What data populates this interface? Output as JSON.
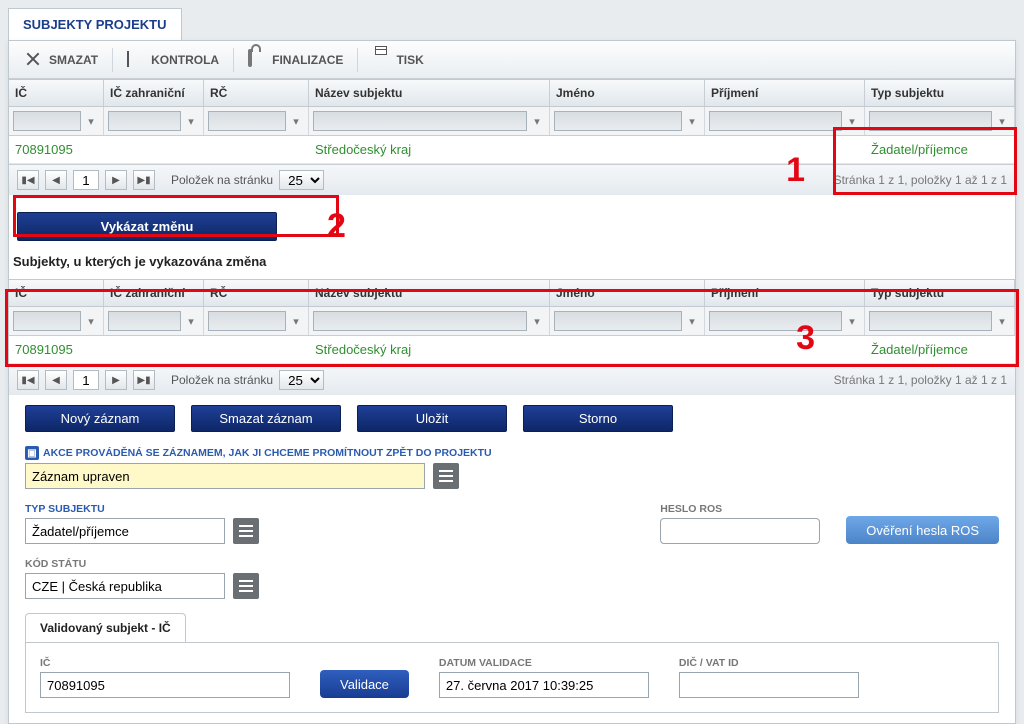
{
  "tab": "SUBJEKTY PROJEKTU",
  "toolbar": {
    "smazat": "SMAZAT",
    "kontrola": "KONTROLA",
    "finalizace": "FINALIZACE",
    "tisk": "TISK"
  },
  "grid_headers": {
    "ic": "IČ",
    "ic_zahr": "IČ zahraniční",
    "rc": "RČ",
    "nazev": "Název subjektu",
    "jmeno": "Jméno",
    "prijmeni": "Příjmení",
    "typ": "Typ subjektu"
  },
  "grid1": {
    "rows": [
      {
        "ic": "70891095",
        "ic_zahr": "",
        "rc": "",
        "nazev": "Středočeský kraj",
        "jmeno": "",
        "prijmeni": "",
        "typ": "Žadatel/příjemce"
      }
    ],
    "pager": {
      "page": "1",
      "page_size_label": "Položek na stránku",
      "page_size": "25",
      "summary": "Stránka 1 z 1, položky 1 až 1 z 1"
    }
  },
  "btn_vykazat": "Vykázat změnu",
  "subtitle": "Subjekty, u kterých je vykazována změna",
  "grid2": {
    "rows": [
      {
        "ic": "70891095",
        "ic_zahr": "",
        "rc": "",
        "nazev": "Středočeský kraj",
        "jmeno": "",
        "prijmeni": "",
        "typ": "Žadatel/příjemce"
      }
    ],
    "pager": {
      "page": "1",
      "page_size_label": "Položek na stránku",
      "page_size": "25",
      "summary": "Stránka 1 z 1, položky 1 až 1 z 1"
    }
  },
  "annotations": {
    "a1": "1",
    "a2": "2",
    "a3": "3"
  },
  "buttons": {
    "novy": "Nový záznam",
    "smazat": "Smazat záznam",
    "ulozit": "Uložit",
    "storno": "Storno",
    "validace": "Validace",
    "overeni_ros": "Ověření hesla ROS"
  },
  "form": {
    "akce_label": "AKCE PROVÁDĚNÁ SE ZÁZNAMEM, JAK JI CHCEME PROMÍTNOUT ZPĚT DO PROJEKTU",
    "akce_value": "Záznam upraven",
    "typ_label": "TYP SUBJEKTU",
    "typ_value": "Žadatel/příjemce",
    "heslo_ros_label": "HESLO ROS",
    "kod_statu_label": "KÓD STÁTU",
    "kod_statu_value": "CZE | Česká republika",
    "subtab": "Validovaný subjekt - IČ",
    "ic_label": "IČ",
    "ic_value": "70891095",
    "datum_label": "DATUM VALIDACE",
    "datum_value": "27. června 2017 10:39:25",
    "dic_label": "DIČ / VAT ID"
  }
}
